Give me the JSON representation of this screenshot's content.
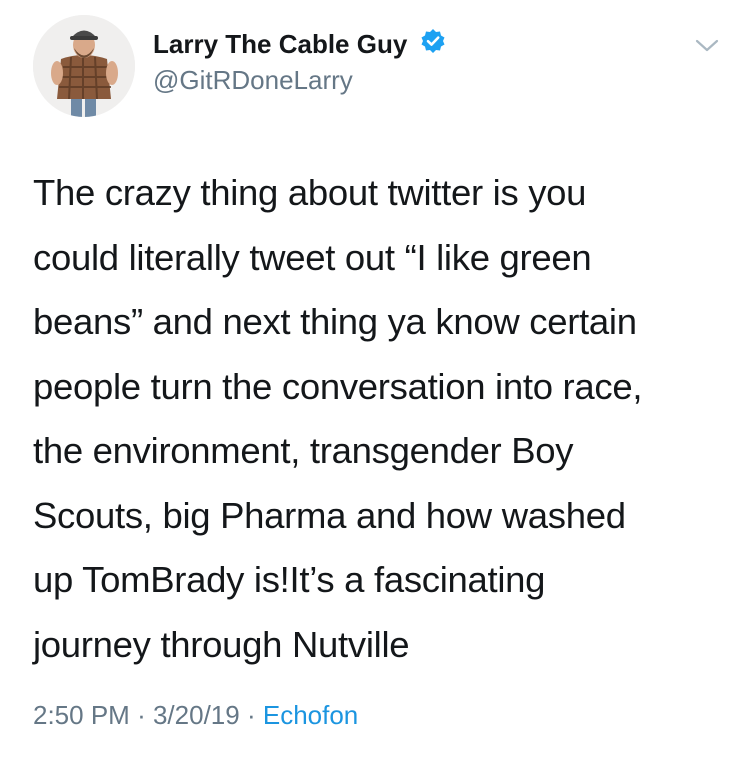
{
  "tweet": {
    "author": {
      "display_name": "Larry The Cable Guy",
      "handle": "@GitRDoneLarry",
      "verified": true,
      "avatar_icon": "profile-photo"
    },
    "text_lines": [
      "The crazy thing about twitter is you",
      "could literally tweet out “I like green",
      "beans” and next thing ya know certain",
      "people turn the conversation into race,",
      "the environment, transgender Boy",
      "Scouts, big Pharma and how washed",
      "up TomBrady is!It’s a fascinating",
      "journey through Nutville"
    ],
    "time": "2:50 PM",
    "date": "3/20/19",
    "separator": "·",
    "source": "Echofon"
  },
  "icons": {
    "verified": "verified-badge-icon",
    "caret": "chevron-down-icon"
  },
  "colors": {
    "text": "#14171a",
    "secondary": "#657786",
    "link": "#1b95e0",
    "verified": "#1da1f2"
  }
}
